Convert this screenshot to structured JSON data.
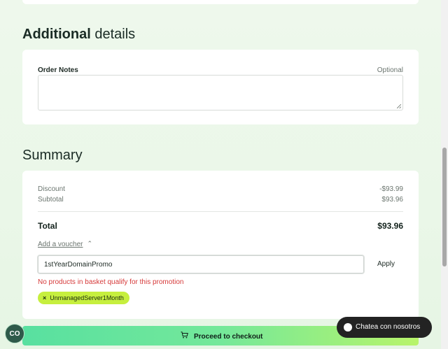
{
  "additional": {
    "title_bold": "Additional",
    "title_light": "details",
    "order_notes_label": "Order Notes",
    "optional_label": "Optional",
    "notes_value": ""
  },
  "summary": {
    "title": "Summary",
    "rows": [
      {
        "label": "Discount",
        "value": "-$93.99"
      },
      {
        "label": "Subtotal",
        "value": "$93.96"
      }
    ],
    "total_label": "Total",
    "total_value": "$93.96",
    "voucher_toggle": "Add a voucher",
    "voucher_value": "1stYearDomainPromo",
    "apply_label": "Apply",
    "error": "No products in basket qualify for this promotion",
    "tag_x": "×",
    "tag_label": "UnmanagedServer1Month"
  },
  "checkout": {
    "label": "Proceed to checkout",
    "icon": "cart-icon"
  },
  "badge": {
    "label": "CO"
  },
  "chat": {
    "label": "Chatea con nosotros",
    "icon": "chat-bubble-icon"
  },
  "colors": {
    "accent_green": "#74e89a",
    "accent_lime": "#c6ef3e",
    "error_red": "#d63a3a",
    "chat_bg": "#232323"
  }
}
